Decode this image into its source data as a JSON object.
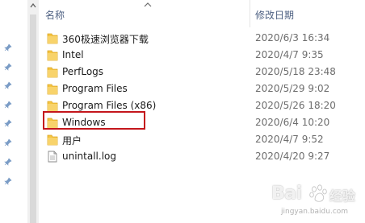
{
  "header": {
    "name_label": "名称",
    "date_label": "修改日期"
  },
  "files": [
    {
      "name": "360极速浏览器下载",
      "date": "2020/6/3 16:34",
      "type": "folder",
      "icon": "folder-icon"
    },
    {
      "name": "Intel",
      "date": "2020/4/7 9:35",
      "type": "folder",
      "icon": "folder-icon"
    },
    {
      "name": "PerfLogs",
      "date": "2020/5/18 23:48",
      "type": "folder",
      "icon": "folder-icon"
    },
    {
      "name": "Program Files",
      "date": "2020/5/29 9:02",
      "type": "folder",
      "icon": "folder-icon"
    },
    {
      "name": "Program Files (x86)",
      "date": "2020/5/26 18:20",
      "type": "folder",
      "icon": "folder-icon"
    },
    {
      "name": "Windows",
      "date": "2020/6/4 10:20",
      "type": "folder",
      "icon": "folder-icon",
      "highlighted": true
    },
    {
      "name": "用户",
      "date": "2020/4/7 9:52",
      "type": "folder",
      "icon": "folder-icon"
    },
    {
      "name": "unintall.log",
      "date": "2020/4/20 9:27",
      "type": "file",
      "icon": "text-file-icon"
    }
  ],
  "watermark": {
    "logo_text": "Bai",
    "logo_suffix": "经验",
    "url": "jingyan.baidu.com"
  },
  "colors": {
    "highlight_border": "#c4161c",
    "folder": "#f5c542",
    "header_text": "#4d6082"
  }
}
